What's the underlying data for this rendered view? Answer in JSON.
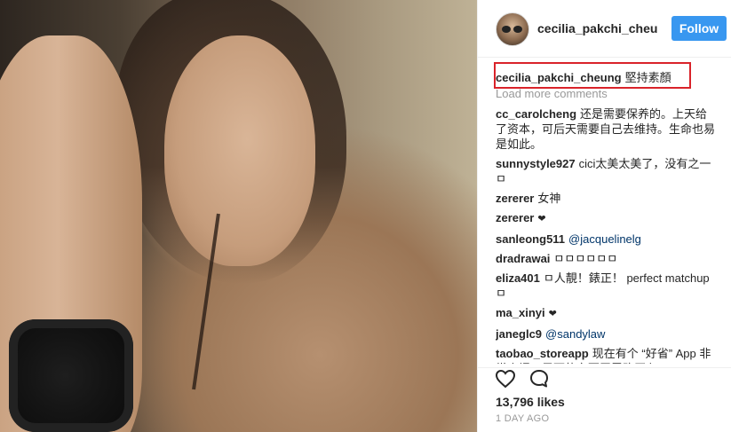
{
  "post": {
    "username": "cecilia_pakchi_cheung",
    "follow_label": "Follow",
    "caption": {
      "user": "cecilia_pakchi_cheung",
      "text": "堅持素顏"
    },
    "load_more": "Load more comments",
    "comments": [
      {
        "user": "cc_carolcheng",
        "text": "还是需要保养的。上天给了资本，可后天需要自己去维持。生命也易是如此。"
      },
      {
        "user": "sunnystyle927",
        "text": "cici太美太美了，没有之一ㅁ"
      },
      {
        "user": "zererer",
        "text": "女神"
      },
      {
        "user": "zererer",
        "text": "❤"
      },
      {
        "user": "sanleong511",
        "text": "@jacquelinelg"
      },
      {
        "user": "dradrawai",
        "text": "ㅁㅁㅁㅁㅁㅁ"
      },
      {
        "user": "eliza401",
        "text": "ㅁ人靚！錶正！ perfect matchup ㅁ"
      },
      {
        "user": "ma_xinyi",
        "text": "❤"
      },
      {
        "user": "janeglc9",
        "text": "@sandylaw"
      },
      {
        "user": "taobao_storeapp",
        "text": "现在有个 “好省” App 非常火爆，里面的东西无需购买卜"
      }
    ],
    "likes": "13,796 likes",
    "date": "1 DAY AGO",
    "icons": {
      "like": "heart-outline-icon",
      "comment": "speech-bubble-icon"
    },
    "colors": {
      "follow_button": "#3897f0",
      "highlight_box": "#d9232a"
    }
  }
}
